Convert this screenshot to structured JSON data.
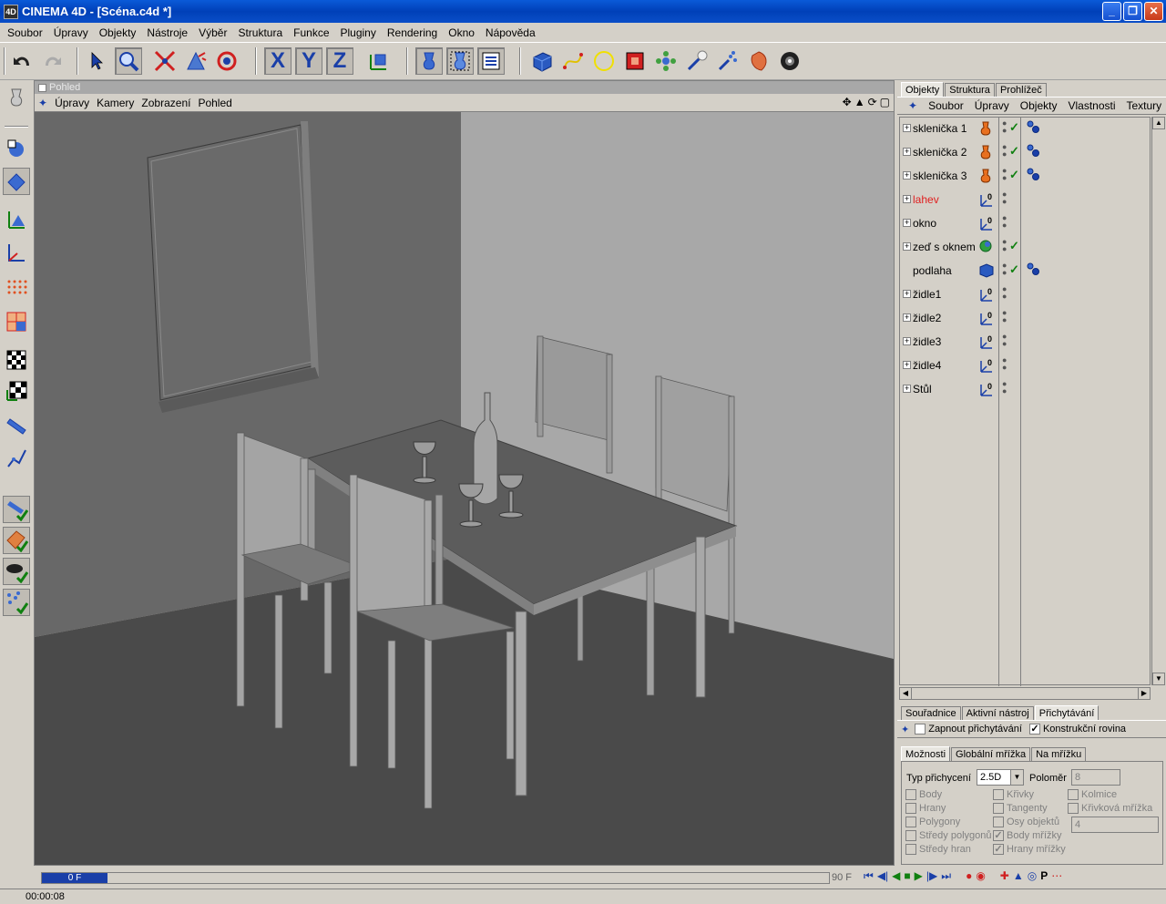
{
  "window": {
    "title": "CINEMA 4D - [Scéna.c4d *]",
    "icon_label": "4D",
    "buttons": {
      "minimize": "_",
      "maximize": "❐",
      "close": "✕"
    }
  },
  "menubar": [
    "Soubor",
    "Úpravy",
    "Objekty",
    "Nástroje",
    "Výběr",
    "Struktura",
    "Funkce",
    "Pluginy",
    "Rendering",
    "Okno",
    "Nápověda"
  ],
  "toolbar": {
    "axis_x": "X",
    "axis_y": "Y",
    "axis_z": "Z"
  },
  "viewport": {
    "title": "Pohled",
    "menu": [
      "Úpravy",
      "Kamery",
      "Zobrazení",
      "Pohled"
    ],
    "nav_icons": [
      "move-icon",
      "pan-icon",
      "rotate-icon",
      "maximize-icon"
    ]
  },
  "objects_panel": {
    "tabs": [
      "Objekty",
      "Struktura",
      "Prohlížeč"
    ],
    "menu": [
      "Soubor",
      "Úpravy",
      "Objekty",
      "Vlastnosti",
      "Textury"
    ],
    "rows": [
      {
        "name": "sklenička 1",
        "icon": "lathe-icon",
        "check": "✓",
        "tag": true,
        "red": false
      },
      {
        "name": "sklenička 2",
        "icon": "lathe-icon",
        "check": "✓",
        "tag": true,
        "red": false
      },
      {
        "name": "sklenička 3",
        "icon": "lathe-icon",
        "check": "✓",
        "tag": true,
        "red": false
      },
      {
        "name": "lahev",
        "icon": "null-icon",
        "check": "",
        "tag": false,
        "red": true
      },
      {
        "name": "okno",
        "icon": "null-icon",
        "check": "",
        "tag": false,
        "red": false
      },
      {
        "name": "zeď s oknem",
        "icon": "boole-icon",
        "check": "✓",
        "tag": false,
        "red": false
      },
      {
        "name": "podlaha",
        "icon": "cube-icon",
        "check": "✓",
        "tag": true,
        "red": false
      },
      {
        "name": "židle1",
        "icon": "null-icon",
        "check": "",
        "tag": false,
        "red": false
      },
      {
        "name": "židle2",
        "icon": "null-icon",
        "check": "",
        "tag": false,
        "red": false
      },
      {
        "name": "židle3",
        "icon": "null-icon",
        "check": "",
        "tag": false,
        "red": false
      },
      {
        "name": "židle4",
        "icon": "null-icon",
        "check": "",
        "tag": false,
        "red": false
      },
      {
        "name": "Stůl",
        "icon": "null-icon",
        "check": "",
        "tag": false,
        "red": false
      }
    ]
  },
  "attributes_panel": {
    "tabs": [
      "Souřadnice",
      "Aktivní nástroj",
      "Přichytávání"
    ],
    "enable_snap_label": "Zapnout přichytávání",
    "enable_snap_checked": false,
    "construction_plane_label": "Konstrukční rovina",
    "construction_plane_checked": true,
    "subtabs": [
      "Možnosti",
      "Globální mřížka",
      "Na mřížku"
    ],
    "snap_type_label": "Typ přichycení",
    "snap_type_value": "2.5D",
    "radius_label": "Poloměr",
    "radius_value": "8",
    "step_value": "4",
    "options_col1": [
      "Body",
      "Hrany",
      "Polygony",
      "Středy polygonů",
      "Středy hran"
    ],
    "options_col2": [
      "Křivky",
      "Tangenty",
      "Osy objektů",
      "Body mřížky",
      "Hrany mřížky"
    ],
    "options_col2_checked": [
      false,
      false,
      false,
      true,
      true
    ],
    "options_col3": [
      "Kolmice",
      "Křivková mřížka"
    ]
  },
  "timeline": {
    "current_frame": "0 F",
    "end_frame": "90 F"
  },
  "status": {
    "time": "00:00:08"
  }
}
